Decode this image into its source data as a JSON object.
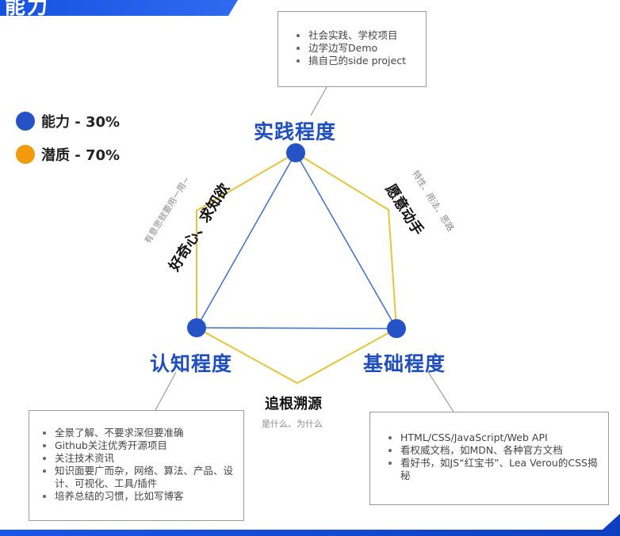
{
  "banner": {
    "text": "能力"
  },
  "legend": [
    {
      "label": "能力 - 30%",
      "color": "#2553c6"
    },
    {
      "label": "潜质 - 70%",
      "color": "#f39a0a"
    }
  ],
  "nodes": {
    "practice": "实践程度",
    "cognition": "认知程度",
    "foundation": "基础程度"
  },
  "edges": {
    "left": {
      "main": "好奇心、求知欲",
      "sub": "有意思就要用一用~"
    },
    "right": {
      "main": "愿意动手",
      "sub": "特性、用法、思路"
    },
    "bottom": {
      "main": "追根溯源",
      "sub": "是什么、为什么"
    }
  },
  "boxes": {
    "top": [
      "社会实践、学校项目",
      "边学边写Demo",
      "搞自己的side project"
    ],
    "left": [
      "全景了解、不要求深但要准确",
      "Github关注优秀开源项目",
      "关注技术资讯",
      "知识面要广而杂，网络、算法、产品、设计、可视化、工具/插件",
      "培养总结的习惯，比如写博客"
    ],
    "right": [
      "HTML/CSS/JavaScript/Web API",
      "看权威文档，如MDN、各种官方文档",
      "看好书，如JS“红宝书”、Lea Verou的CSS揭秘"
    ]
  },
  "colors": {
    "triangle": "#3a6fd0",
    "hexagon": "#e8c43a",
    "node": "#2553c6",
    "connector": "#8a8a8a"
  }
}
